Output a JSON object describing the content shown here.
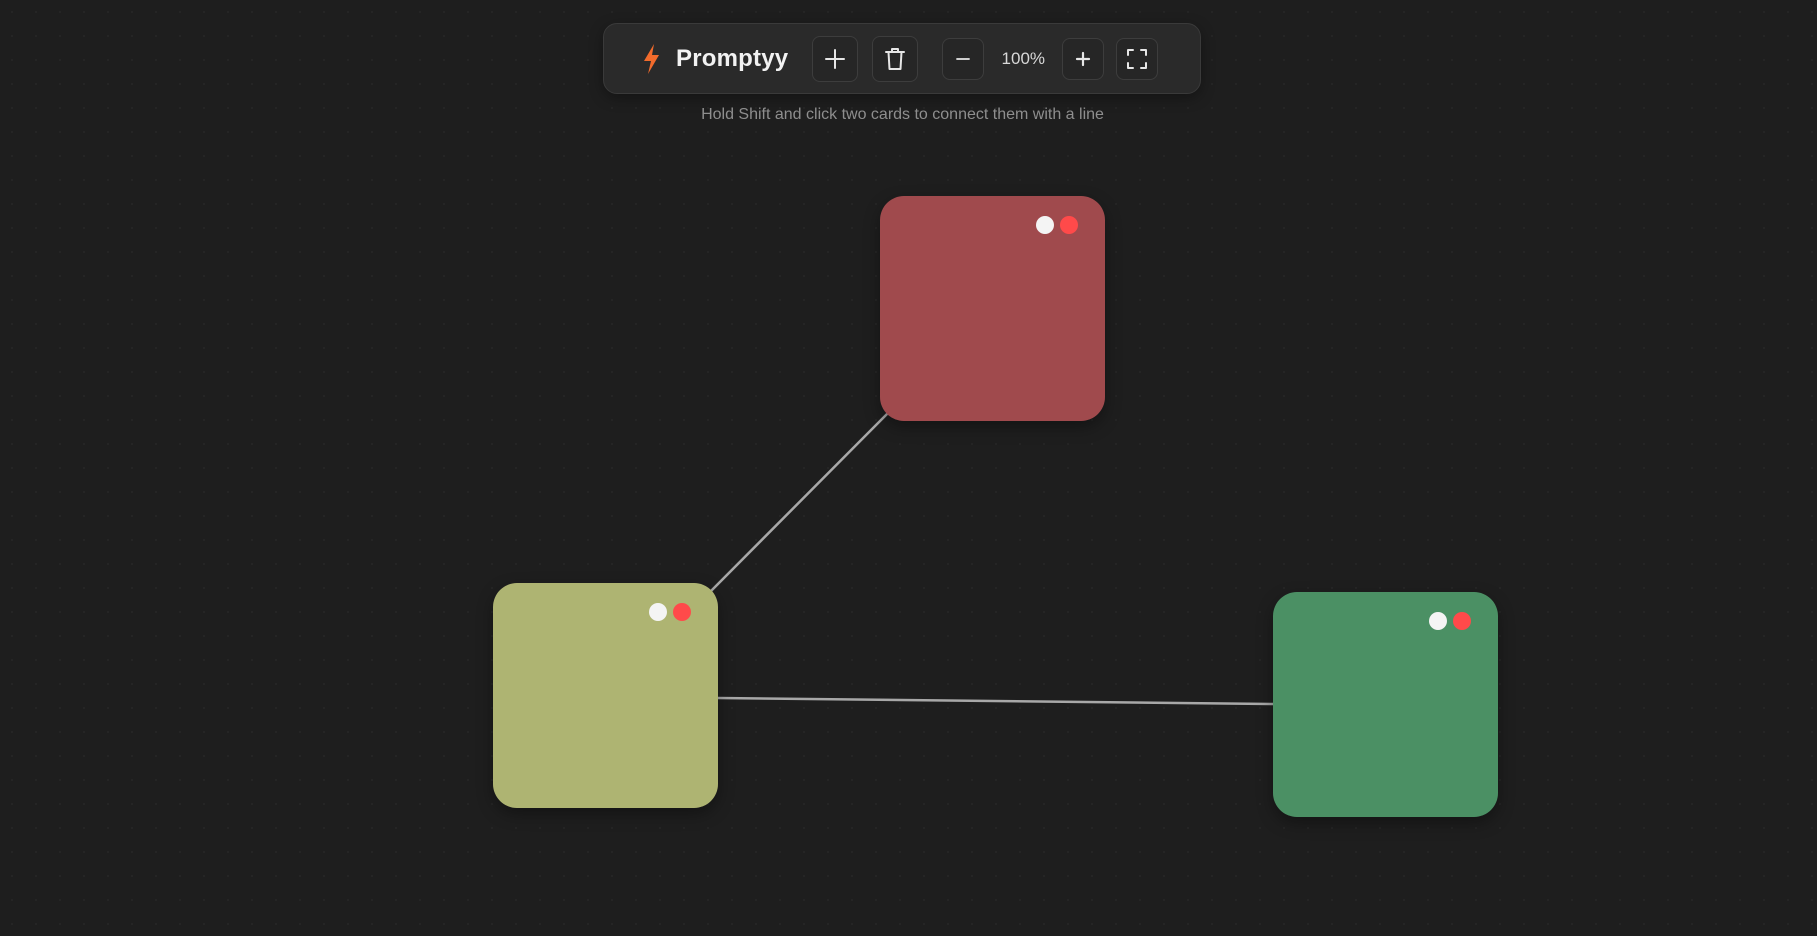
{
  "app": {
    "title": "Promptyy",
    "brand_icon": "lightning-bolt-icon",
    "accent_color": "#f26b2c"
  },
  "toolbar": {
    "add_icon": "plus-icon",
    "delete_icon": "trash-icon",
    "zoom_out_icon": "minus-icon",
    "zoom_level": "100%",
    "zoom_in_icon": "plus-icon",
    "fullscreen_icon": "fullscreen-icon"
  },
  "hint": "Hold Shift and click two cards to connect them with a line",
  "cards": [
    {
      "id": "red",
      "color": "#a04a4d"
    },
    {
      "id": "olive",
      "color": "#aeb472"
    },
    {
      "id": "green",
      "color": "#4b9064"
    }
  ],
  "card_controls": {
    "white_dot_color": "#f4f4f4",
    "red_dot_color": "#ff4a4a"
  },
  "connections": [
    {
      "from": "olive",
      "to": "red"
    },
    {
      "from": "olive",
      "to": "green"
    }
  ]
}
